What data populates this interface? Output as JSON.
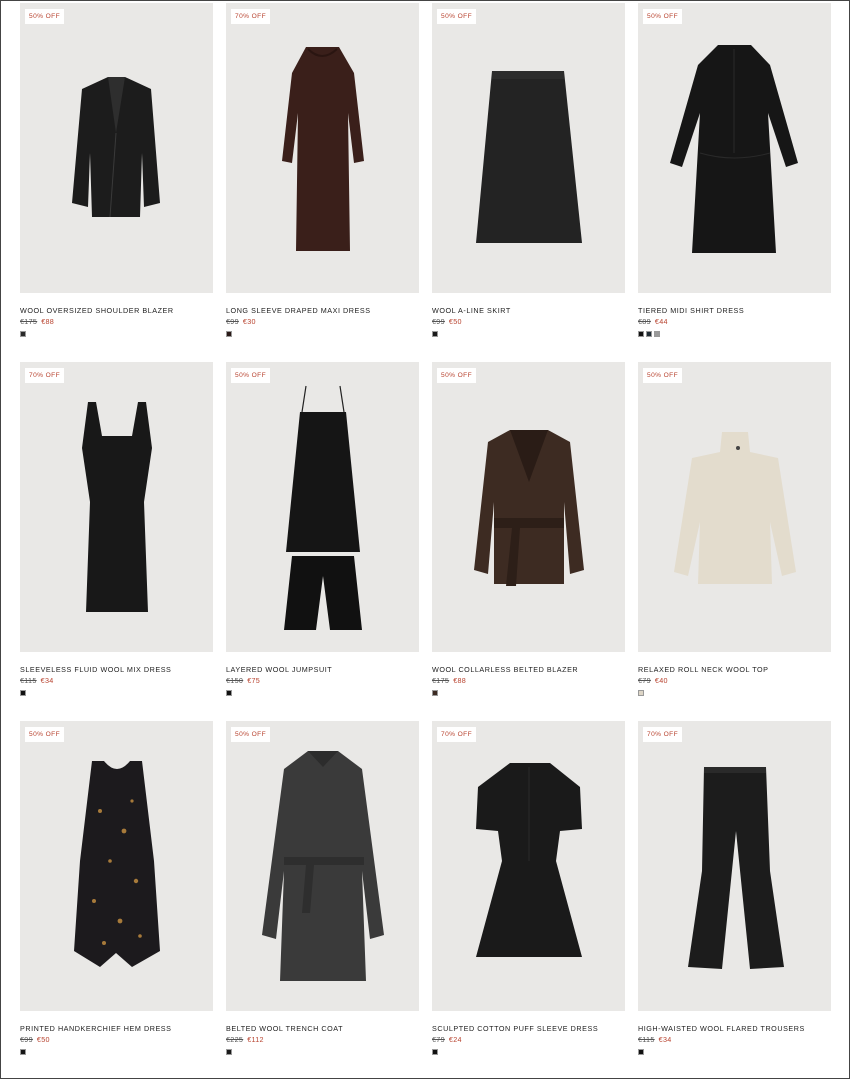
{
  "products": [
    {
      "badge": "50% OFF",
      "name": "WOOL OVERSIZED SHOULDER BLAZER",
      "old_price": "€175",
      "new_price": "€88",
      "swatches": [
        "#2a2a2a"
      ],
      "garment": "blazer",
      "color": "#1c1c1c"
    },
    {
      "badge": "70% OFF",
      "name": "LONG SLEEVE DRAPED MAXI DRESS",
      "old_price": "€99",
      "new_price": "€30",
      "swatches": [
        "#2a1a17"
      ],
      "garment": "maxi",
      "color": "#3a1f1a"
    },
    {
      "badge": "50% OFF",
      "name": "WOOL A-LINE SKIRT",
      "old_price": "€99",
      "new_price": "€50",
      "swatches": [
        "#1a1a1a"
      ],
      "garment": "skirt",
      "color": "#232323"
    },
    {
      "badge": "50% OFF",
      "name": "TIERED MIDI SHIRT DRESS",
      "old_price": "€89",
      "new_price": "€44",
      "swatches": [
        "#111111",
        "#1f2b33",
        "#9a9a9a"
      ],
      "garment": "shirtdress",
      "color": "#161616"
    },
    {
      "badge": "70% OFF",
      "name": "SLEEVELESS FLUID WOOL MIX DRESS",
      "old_price": "€115",
      "new_price": "€34",
      "swatches": [
        "#111111"
      ],
      "garment": "slipdress",
      "color": "#181818"
    },
    {
      "badge": "50% OFF",
      "name": "LAYERED WOOL JUMPSUIT",
      "old_price": "€150",
      "new_price": "€75",
      "swatches": [
        "#111111"
      ],
      "garment": "jumpsuit",
      "color": "#151515"
    },
    {
      "badge": "50% OFF",
      "name": "WOOL COLLARLESS BELTED BLAZER",
      "old_price": "€175",
      "new_price": "€88",
      "swatches": [
        "#3b2a22"
      ],
      "garment": "beltedblazer",
      "color": "#3d2b22"
    },
    {
      "badge": "50% OFF",
      "name": "RELAXED ROLL NECK WOOL TOP",
      "old_price": "€79",
      "new_price": "€40",
      "swatches": [
        "#ddd5c6"
      ],
      "garment": "rollneck",
      "color": "#e3dccd"
    },
    {
      "badge": "50% OFF",
      "name": "PRINTED HANDKERCHIEF HEM DRESS",
      "old_price": "€99",
      "new_price": "€50",
      "swatches": [
        "#151515"
      ],
      "garment": "printdress",
      "color": "#1c1a1d"
    },
    {
      "badge": "50% OFF",
      "name": "BELTED WOOL TRENCH COAT",
      "old_price": "€225",
      "new_price": "€112",
      "swatches": [
        "#1a1a1a"
      ],
      "garment": "trench",
      "color": "#3a3a3a"
    },
    {
      "badge": "70% OFF",
      "name": "SCULPTED COTTON PUFF SLEEVE DRESS",
      "old_price": "€79",
      "new_price": "€24",
      "swatches": [
        "#111111"
      ],
      "garment": "puffdress",
      "color": "#1a1a1a"
    },
    {
      "badge": "70% OFF",
      "name": "HIGH-WAISTED WOOL FLARED TROUSERS",
      "old_price": "€115",
      "new_price": "€34",
      "swatches": [
        "#111111"
      ],
      "garment": "trousers",
      "color": "#1c1c1c"
    }
  ]
}
